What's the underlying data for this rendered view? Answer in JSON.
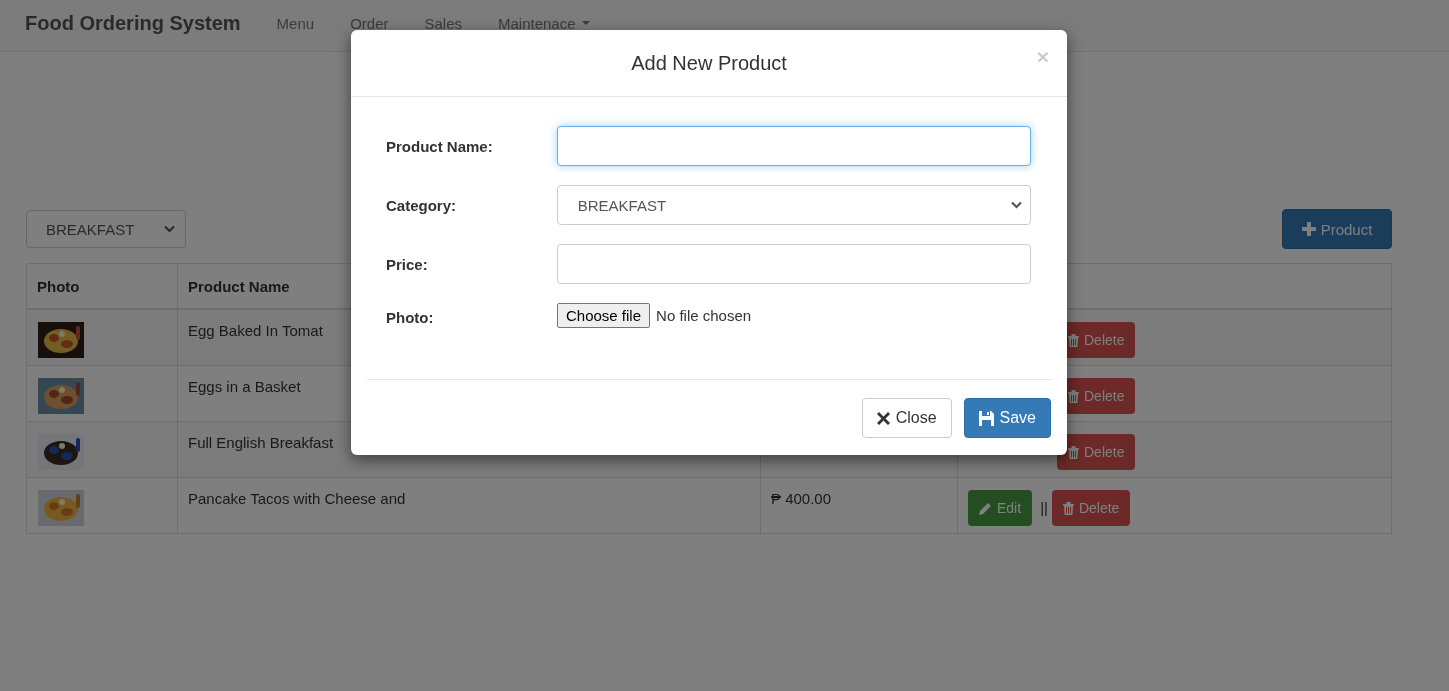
{
  "navbar": {
    "brand": "Food Ordering System",
    "items": [
      {
        "label": "Menu",
        "dropdown": false
      },
      {
        "label": "Order",
        "dropdown": false
      },
      {
        "label": "Sales",
        "dropdown": false
      },
      {
        "label": "Maintenace",
        "dropdown": true
      }
    ]
  },
  "toolbar": {
    "category_filter": "BREAKFAST",
    "add_button": "Product"
  },
  "table": {
    "columns": [
      "Photo",
      "Product Name"
    ],
    "rows": [
      {
        "name": "Egg Baked In Tomat",
        "delete": "Delete"
      },
      {
        "name": "Eggs in a Basket",
        "delete": "Delete"
      },
      {
        "name": "Full English Breakfast",
        "delete": "Delete"
      },
      {
        "name": "Pancake Tacos with Cheese and",
        "price": "₱ 400.00",
        "edit": "Edit",
        "separator": "||",
        "delete": "Delete"
      }
    ]
  },
  "modal": {
    "title": "Add New Product",
    "close_icon": "×",
    "fields": [
      {
        "kind": "text",
        "label": "Product Name:",
        "focused": true
      },
      {
        "kind": "select",
        "label": "Category:",
        "value": "BREAKFAST"
      },
      {
        "kind": "text",
        "label": "Price:",
        "focused": false
      },
      {
        "kind": "file",
        "label": "Photo:",
        "button": "Choose file",
        "status": "No file chosen"
      }
    ],
    "buttons": [
      {
        "kind": "default",
        "label": "Close"
      },
      {
        "kind": "primary",
        "label": "Save"
      }
    ]
  }
}
